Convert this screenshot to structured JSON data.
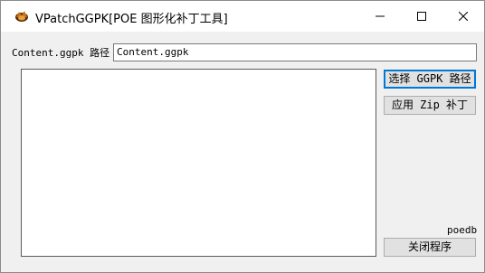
{
  "window": {
    "title": "VPatchGGPK[POE 图形化补丁工具]",
    "icon": "game-logo-icon",
    "controls": {
      "minimize": "minimize-icon",
      "maximize": "maximize-icon",
      "close": "close-icon"
    }
  },
  "path": {
    "label": "Content.ggpk 路径",
    "value": "Content.ggpk"
  },
  "buttons": {
    "select_ggpk": "选择 GGPK 路径",
    "apply_zip": "应用 Zip 补丁",
    "close_program": "关闭程序"
  },
  "credit": "poedb",
  "colors": {
    "accent": "#0078d7",
    "window_bg": "#f0f0f0",
    "button_bg": "#e1e1e1"
  }
}
